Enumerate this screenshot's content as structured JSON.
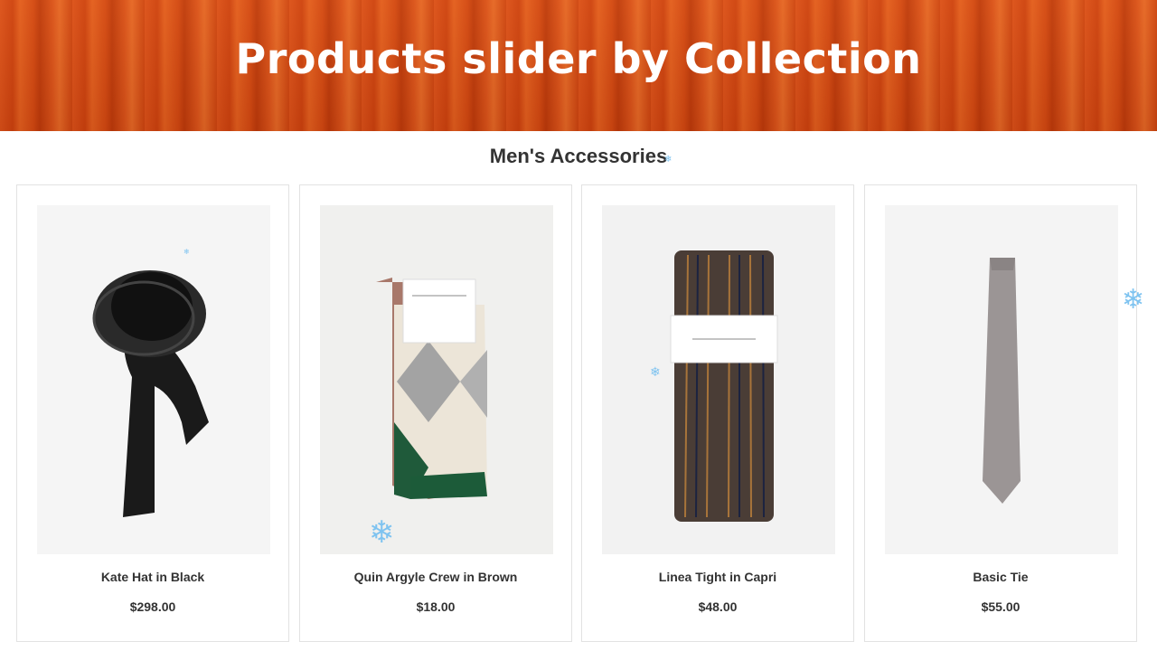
{
  "banner": {
    "title": "Products slider by Collection"
  },
  "section": {
    "title": "Men's Accessories"
  },
  "products": [
    {
      "name": "Kate Hat in Black",
      "price": "$298.00",
      "image_icon": "hat-icon"
    },
    {
      "name": "Quin Argyle Crew in Brown",
      "price": "$18.00",
      "image_icon": "socks-icon"
    },
    {
      "name": "Linea Tight in Capri",
      "price": "$48.00",
      "image_icon": "tights-icon"
    },
    {
      "name": "Basic Tie",
      "price": "$55.00",
      "image_icon": "tie-icon"
    }
  ],
  "decoration": {
    "icon": "snowflake-icon",
    "glyph": "❄",
    "color": "#7ec3f0"
  }
}
